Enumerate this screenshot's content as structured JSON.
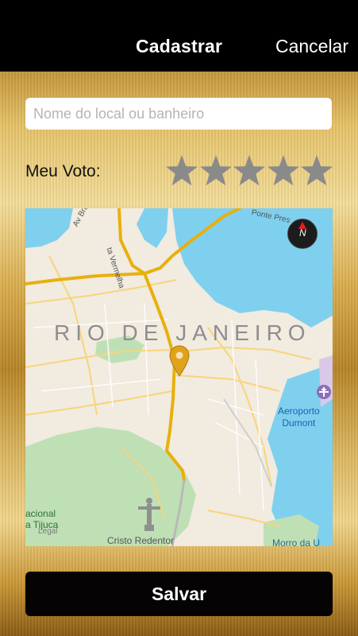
{
  "navbar": {
    "title": "Cadastrar",
    "cancel_label": "Cancelar"
  },
  "form": {
    "name_placeholder": "Nome do local ou banheiro",
    "vote_label": "Meu Voto:",
    "stars_total": 5,
    "stars_selected": 0,
    "star_color": "#8a8a8a"
  },
  "map": {
    "city_label": "RIO DE JANEIRO",
    "airport_label_line1": "Aeroporto",
    "airport_label_line2": "Dumont",
    "landmark_label": "Cristo Redentor",
    "hill_label": "Morro da U",
    "park_label_line1": "acional",
    "park_label_line2": "a Tijuca",
    "legal_label": "Legal",
    "street_labels": [
      "Av Brasil",
      "ta Vermelha",
      "Ponte Pres"
    ],
    "compass_label": "N",
    "water_color": "#7fd0ef",
    "route_color": "#e8b00c"
  },
  "actions": {
    "save_label": "Salvar"
  },
  "colors": {
    "navbar": "#000000",
    "button": "#050303"
  }
}
